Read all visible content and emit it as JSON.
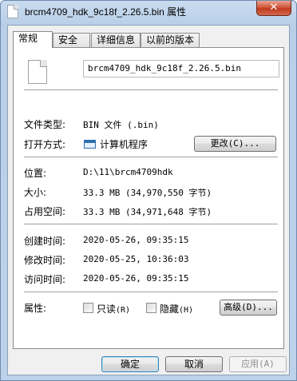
{
  "window": {
    "title": "brcm4709_hdk_9c18f_2.26.5.bin 属性",
    "close_glyph": "✕"
  },
  "tabs": [
    {
      "label": "常规",
      "active": true
    },
    {
      "label": "安全",
      "active": false
    },
    {
      "label": "详细信息",
      "active": false
    },
    {
      "label": "以前的版本",
      "active": false
    }
  ],
  "general": {
    "file_name": "brcm4709_hdk_9c18f_2.26.5.bin",
    "file_type_label": "文件类型:",
    "file_type_value": "BIN 文件 (.bin)",
    "opens_with_label": "打开方式:",
    "opens_with_value": "计算机程序",
    "change_button": "更改(C)...",
    "location_label": "位置:",
    "location_value": "D:\\11\\brcm4709hdk",
    "size_label": "大小:",
    "size_value": "33.3 MB (34,970,550 字节)",
    "size_on_disk_label": "占用空间:",
    "size_on_disk_value": "33.3 MB (34,971,648 字节)",
    "created_label": "创建时间:",
    "created_value": "2020-05-26, 09:35:15",
    "modified_label": "修改时间:",
    "modified_value": "2020-05-25, 10:36:03",
    "accessed_label": "访问时间:",
    "accessed_value": "2020-05-26, 09:35:15",
    "attributes_label": "属性:",
    "readonly_label": "只读",
    "readonly_key": "(R)",
    "readonly_checked": false,
    "hidden_label": "隐藏",
    "hidden_key": "(H)",
    "hidden_checked": false,
    "advanced_button": "高级(D)..."
  },
  "footer": {
    "ok_button": "确定",
    "cancel_button": "取消",
    "apply_button": "应用(A)"
  },
  "icons": {
    "title": "file-icon",
    "file": "blank-file-icon",
    "app": "window-app-icon"
  }
}
